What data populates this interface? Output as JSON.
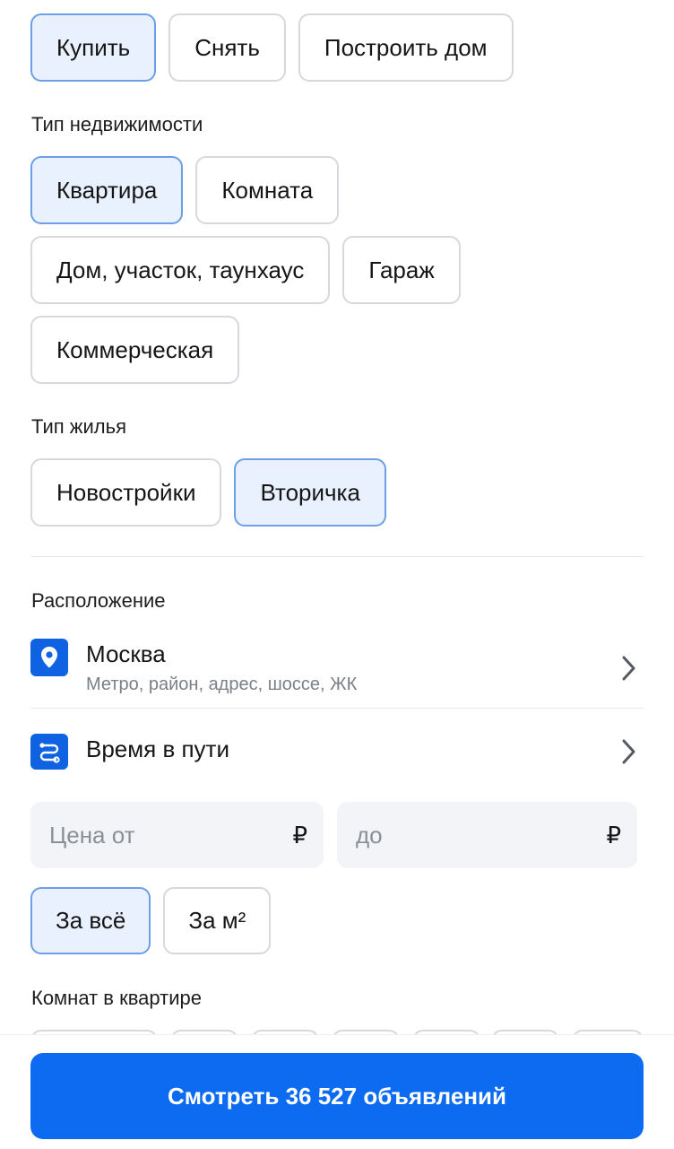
{
  "deal_type": {
    "options": [
      {
        "label": "Купить",
        "selected": true
      },
      {
        "label": "Снять",
        "selected": false
      },
      {
        "label": "Построить дом",
        "selected": false
      }
    ]
  },
  "property_type": {
    "label": "Тип недвижимости",
    "options": [
      {
        "label": "Квартира",
        "selected": true
      },
      {
        "label": "Комната",
        "selected": false
      },
      {
        "label": "Дом, участок, таунхаус",
        "selected": false
      },
      {
        "label": "Гараж",
        "selected": false
      },
      {
        "label": "Коммерческая",
        "selected": false
      }
    ]
  },
  "housing_type": {
    "label": "Тип жилья",
    "options": [
      {
        "label": "Новостройки",
        "selected": false
      },
      {
        "label": "Вторичка",
        "selected": true
      }
    ]
  },
  "location": {
    "label": "Расположение",
    "city": "Москва",
    "city_hint": "Метро, район, адрес, шоссе, ЖК",
    "city_icon": "location-pin-icon",
    "travel_time": "Время в пути",
    "travel_icon": "route-icon"
  },
  "price": {
    "from_placeholder": "Цена от",
    "to_placeholder": "до",
    "currency": "₽",
    "modes": [
      {
        "label": "За всё",
        "selected": true
      },
      {
        "label": "За м²",
        "selected": false
      }
    ]
  },
  "rooms": {
    "label": "Комнат в квартире"
  },
  "submit": {
    "label": "Смотреть 36 527 объявлений"
  },
  "colors": {
    "accent": "#0d6bf2",
    "selected_chip_bg": "#e8f1fd",
    "selected_chip_border": "#6c9fe6"
  }
}
